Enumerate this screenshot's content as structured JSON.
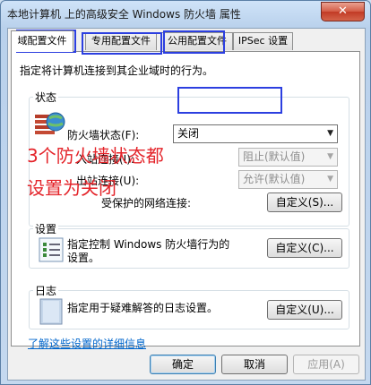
{
  "window": {
    "title": "本地计算机 上的高级安全 Windows 防火墙 属性",
    "close_glyph": "✕"
  },
  "tabs": [
    {
      "label": "域配置文件",
      "active": true
    },
    {
      "label": "专用配置文件",
      "active": false
    },
    {
      "label": "公用配置文件",
      "active": false
    },
    {
      "label": "IPSec 设置",
      "active": false
    }
  ],
  "panel": {
    "description": "指定将计算机连接到其企业域时的行为。"
  },
  "state": {
    "group_label": "状态",
    "firewall_state_label": "防火墙状态(F):",
    "firewall_state_value": "关闭",
    "inbound_label": "入站连接(I):",
    "inbound_value": "阻止(默认值)",
    "outbound_label": "出站连接(U):",
    "outbound_value": "允许(默认值)",
    "protected_label": "受保护的网络连接:",
    "protected_button": "自定义(S)..."
  },
  "settings": {
    "group_label": "设置",
    "description_line1": "指定控制 Windows 防火墙行为的",
    "description_line2": "设置。",
    "button": "自定义(C)..."
  },
  "logging": {
    "group_label": "日志",
    "description": "指定用于疑难解答的日志设置。",
    "button": "自定义(U)..."
  },
  "link": {
    "label": "了解这些设置的详细信息"
  },
  "footer": {
    "ok": "确定",
    "cancel": "取消",
    "apply": "应用(A)"
  },
  "annotation": {
    "line1": "3个防火墙状态都",
    "line2": "设置为关闭",
    "text_color": "#e4242a",
    "box_color": "#2c3fe0"
  },
  "icons": {
    "shield": "firewall-shield-icon",
    "settings": "checklist-icon",
    "log": "notebook-icon"
  }
}
